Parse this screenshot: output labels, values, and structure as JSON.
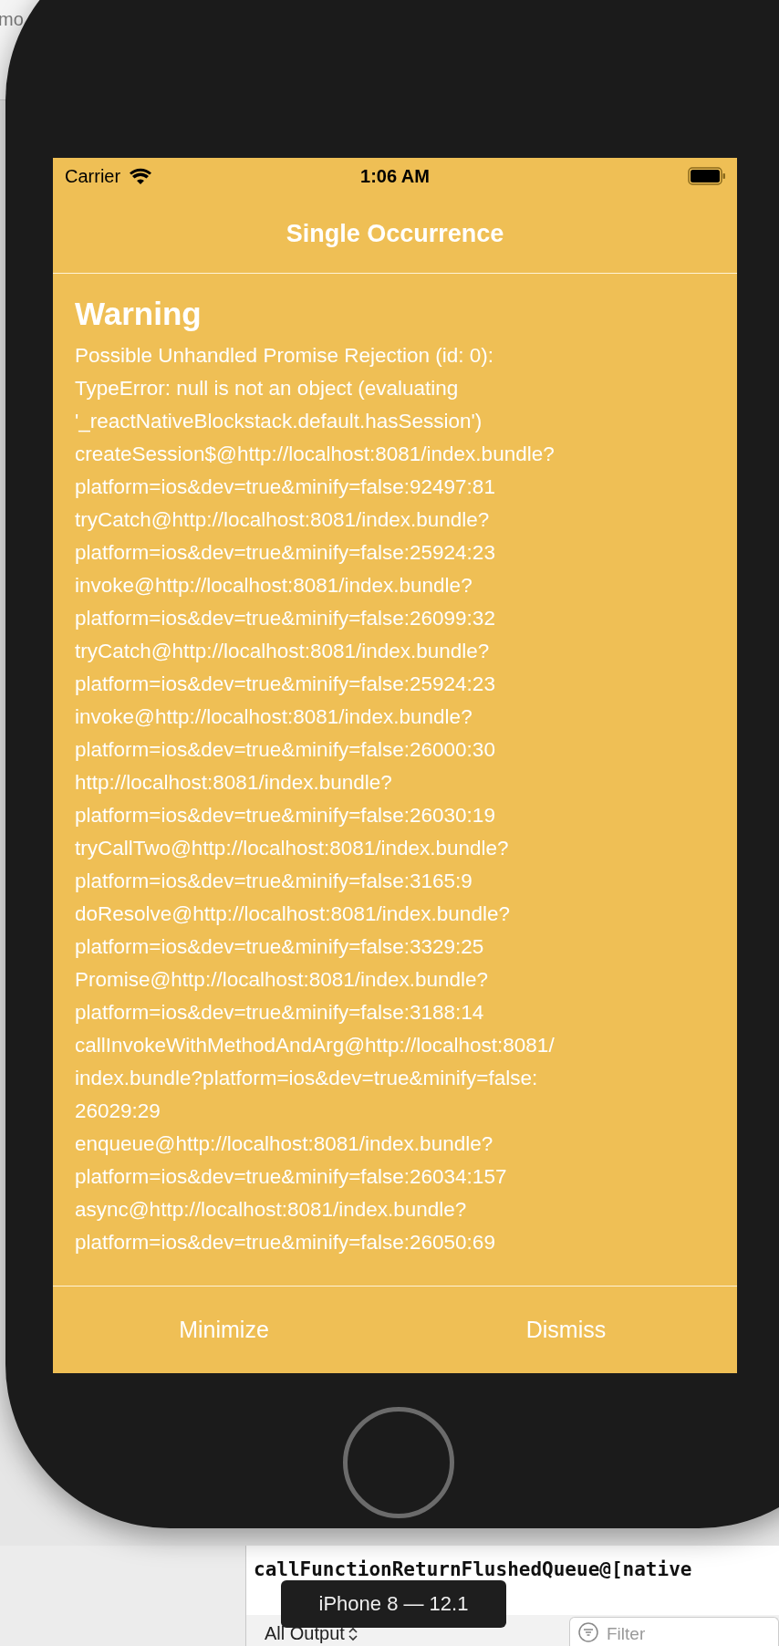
{
  "background_window": {
    "toolbar_fragment": "mo",
    "console_line": "callFunctionReturnFlushedQueue@[native",
    "output_selector": "All Output",
    "filter": {
      "placeholder": "Filter"
    }
  },
  "device_tooltip": "iPhone 8 — 12.1",
  "status_bar": {
    "carrier": "Carrier",
    "time": "1:06 AM"
  },
  "nav_title": "Single Occurrence",
  "warning": {
    "heading": "Warning",
    "message": "Possible Unhandled Promise Rejection (id: 0):\nTypeError: null is not an object (evaluating\n'_reactNativeBlockstack.default.hasSession')\ncreateSession$@http://localhost:8081/index.bundle?\nplatform=ios&dev=true&minify=false:92497:81\ntryCatch@http://localhost:8081/index.bundle?\nplatform=ios&dev=true&minify=false:25924:23\ninvoke@http://localhost:8081/index.bundle?\nplatform=ios&dev=true&minify=false:26099:32\ntryCatch@http://localhost:8081/index.bundle?\nplatform=ios&dev=true&minify=false:25924:23\ninvoke@http://localhost:8081/index.bundle?\nplatform=ios&dev=true&minify=false:26000:30\nhttp://localhost:8081/index.bundle?\nplatform=ios&dev=true&minify=false:26030:19\ntryCallTwo@http://localhost:8081/index.bundle?\nplatform=ios&dev=true&minify=false:3165:9\ndoResolve@http://localhost:8081/index.bundle?\nplatform=ios&dev=true&minify=false:3329:25\nPromise@http://localhost:8081/index.bundle?\nplatform=ios&dev=true&minify=false:3188:14\ncallInvokeWithMethodAndArg@http://localhost:8081/\nindex.bundle?platform=ios&dev=true&minify=false:\n26029:29\nenqueue@http://localhost:8081/index.bundle?\nplatform=ios&dev=true&minify=false:26034:157\nasync@http://localhost:8081/index.bundle?\nplatform=ios&dev=true&minify=false:26050:69"
  },
  "buttons": [
    "Minimize",
    "Dismiss"
  ]
}
